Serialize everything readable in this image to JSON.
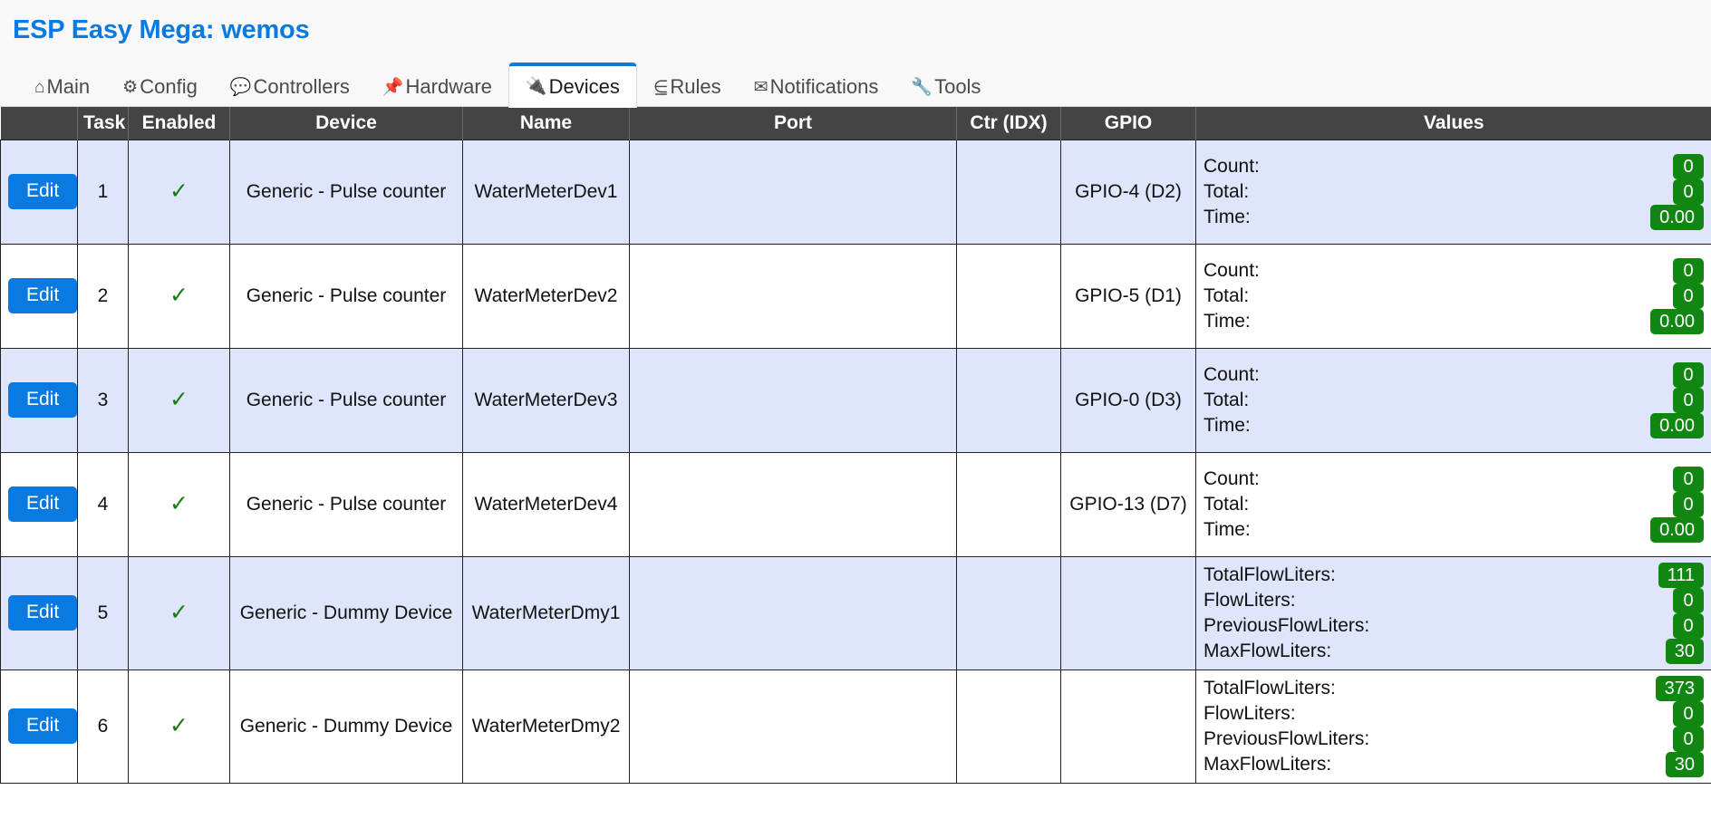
{
  "header": {
    "title": "ESP Easy Mega: wemos"
  },
  "nav": {
    "tabs": [
      {
        "label": "Main",
        "icon": "⌂",
        "icon_name": "home-icon",
        "active": false
      },
      {
        "label": "Config",
        "icon": "⚙",
        "icon_name": "gear-icon",
        "active": false
      },
      {
        "label": "Controllers",
        "icon": "💬",
        "icon_name": "speech-bubble-icon",
        "active": false
      },
      {
        "label": "Hardware",
        "icon": "📌",
        "icon_name": "pushpin-icon",
        "active": false
      },
      {
        "label": "Devices",
        "icon": "🔌",
        "icon_name": "plug-icon",
        "active": true
      },
      {
        "label": "Rules",
        "icon": "⋸",
        "icon_name": "rules-arrow-icon",
        "active": false
      },
      {
        "label": "Notifications",
        "icon": "✉",
        "icon_name": "envelope-icon",
        "active": false
      },
      {
        "label": "Tools",
        "icon": "🔧",
        "icon_name": "wrench-icon",
        "active": false
      }
    ]
  },
  "table": {
    "columns": [
      "",
      "Task",
      "Enabled",
      "Device",
      "Name",
      "Port",
      "Ctr (IDX)",
      "GPIO",
      "Values"
    ],
    "edit_label": "Edit",
    "enabled_mark": "✓",
    "rows": [
      {
        "task": "1",
        "enabled": "✓",
        "device": "Generic - Pulse counter",
        "name": "WaterMeterDev1",
        "port": "",
        "ctr_idx": "",
        "gpio": "GPIO-4 (D2)",
        "values": [
          {
            "label": "Count:",
            "value": "0"
          },
          {
            "label": "Total:",
            "value": "0"
          },
          {
            "label": "Time:",
            "value": "0.00"
          }
        ]
      },
      {
        "task": "2",
        "enabled": "✓",
        "device": "Generic - Pulse counter",
        "name": "WaterMeterDev2",
        "port": "",
        "ctr_idx": "",
        "gpio": "GPIO-5 (D1)",
        "values": [
          {
            "label": "Count:",
            "value": "0"
          },
          {
            "label": "Total:",
            "value": "0"
          },
          {
            "label": "Time:",
            "value": "0.00"
          }
        ]
      },
      {
        "task": "3",
        "enabled": "✓",
        "device": "Generic - Pulse counter",
        "name": "WaterMeterDev3",
        "port": "",
        "ctr_idx": "",
        "gpio": "GPIO-0 (D3)",
        "values": [
          {
            "label": "Count:",
            "value": "0"
          },
          {
            "label": "Total:",
            "value": "0"
          },
          {
            "label": "Time:",
            "value": "0.00"
          }
        ]
      },
      {
        "task": "4",
        "enabled": "✓",
        "device": "Generic - Pulse counter",
        "name": "WaterMeterDev4",
        "port": "",
        "ctr_idx": "",
        "gpio": "GPIO-13 (D7)",
        "values": [
          {
            "label": "Count:",
            "value": "0"
          },
          {
            "label": "Total:",
            "value": "0"
          },
          {
            "label": "Time:",
            "value": "0.00"
          }
        ]
      },
      {
        "task": "5",
        "enabled": "✓",
        "device": "Generic - Dummy Device",
        "name": "WaterMeterDmy1",
        "port": "",
        "ctr_idx": "",
        "gpio": "",
        "values": [
          {
            "label": "TotalFlowLiters:",
            "value": "111"
          },
          {
            "label": "FlowLiters:",
            "value": "0"
          },
          {
            "label": "PreviousFlowLiters:",
            "value": "0"
          },
          {
            "label": "MaxFlowLiters:",
            "value": "30"
          }
        ]
      },
      {
        "task": "6",
        "enabled": "✓",
        "device": "Generic - Dummy Device",
        "name": "WaterMeterDmy2",
        "port": "",
        "ctr_idx": "",
        "gpio": "",
        "values": [
          {
            "label": "TotalFlowLiters:",
            "value": "373"
          },
          {
            "label": "FlowLiters:",
            "value": "0"
          },
          {
            "label": "PreviousFlowLiters:",
            "value": "0"
          },
          {
            "label": "MaxFlowLiters:",
            "value": "30"
          }
        ]
      }
    ]
  },
  "colors": {
    "accent": "#0a7ae0",
    "header_bg": "#444444",
    "alt_row": "#dfe5fb",
    "badge_green": "#108710",
    "check_green": "#167c16"
  }
}
